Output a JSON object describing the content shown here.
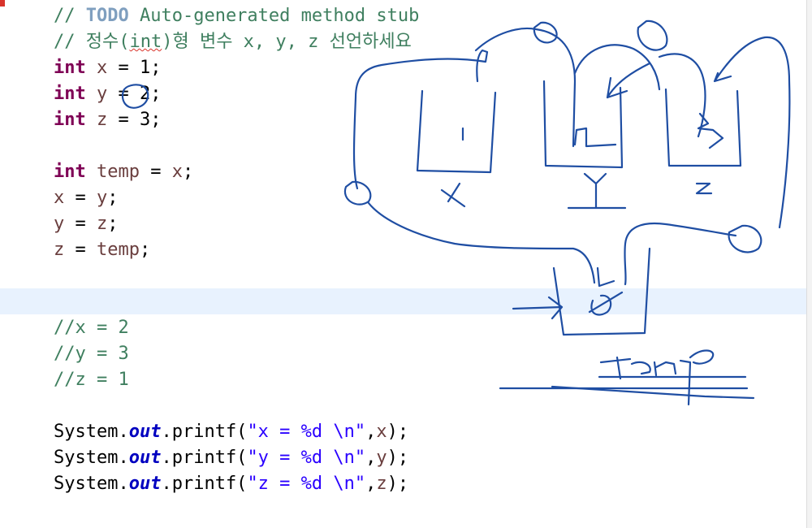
{
  "editor": {
    "lines": {
      "todo_prefix": "// ",
      "todo_tag": "TODO",
      "todo_text": " Auto-generated method stub",
      "comment_prefix": "// 정수(",
      "comment_int": "int",
      "comment_suffix": ")형 변수 x, y, z 선언하세요",
      "decl_x": {
        "type": "int",
        "name": "x",
        "rest": " = 1;"
      },
      "decl_y": {
        "type": "int",
        "name": "y",
        "rest": " = 2;"
      },
      "decl_z": {
        "type": "int",
        "name": "z",
        "rest": " = 3;"
      },
      "decl_temp": {
        "type": "int",
        "name": "temp",
        "eq": " = ",
        "val": "x",
        "end": ";"
      },
      "assign_1": {
        "lhs": "x",
        "eq": " = ",
        "rhs": "y",
        "end": ";"
      },
      "assign_2": {
        "lhs": "y",
        "eq": " = ",
        "rhs": "z",
        "end": ";"
      },
      "assign_3": {
        "lhs": "z",
        "eq": " = ",
        "rhs": "temp",
        "end": ";"
      },
      "note_x": "//x = 2",
      "note_y": "//y = 3",
      "note_z": "//z = 1",
      "print_x": {
        "cls": "System.",
        "field": "out",
        "call": ".printf(",
        "str": "\"x = %d \\n\"",
        "sep": ",",
        "arg": "x",
        "end": ");"
      },
      "print_y": {
        "cls": "System.",
        "field": "out",
        "call": ".printf(",
        "str": "\"y = %d \\n\"",
        "sep": ",",
        "arg": "y",
        "end": ");"
      },
      "print_z": {
        "cls": "System.",
        "field": "out",
        "call": ".printf(",
        "str": "\"z = %d \\n\"",
        "sep": ",",
        "arg": "z",
        "end": ");"
      }
    }
  },
  "annotations": {
    "ink_color": "#1f4ea3",
    "labels": [
      "x",
      "y",
      "z",
      "temp"
    ]
  }
}
